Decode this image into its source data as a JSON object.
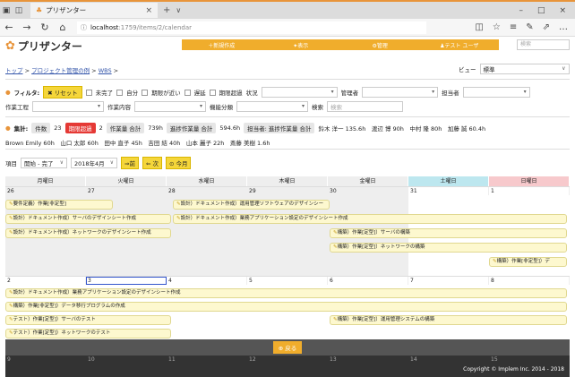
{
  "browser": {
    "tab_title": "プリザンター",
    "url_host": "localhost",
    "url_path": ":1759/items/2/calendar"
  },
  "app": {
    "logo_text": "プリザンター",
    "menu": [
      "＋新規作成",
      "✦表示",
      "⚙管理",
      "♟テスト ユーザ"
    ],
    "search_placeholder": "検索"
  },
  "breadcrumb": [
    "トップ",
    "プロジェクト管理の例",
    "WBS"
  ],
  "view": {
    "label": "ビュー",
    "value": "標準"
  },
  "filter": {
    "title": "フィルタ:",
    "reset": "✖ リセット",
    "checks": [
      "未完了",
      "自分",
      "期限が近い",
      "遅延",
      "期限超過"
    ],
    "status_label": "状況",
    "manager_label": "管理者",
    "owner_label": "担当者",
    "process_label": "作業工程",
    "content_label": "作業内容",
    "category_label": "機能分類",
    "search_label": "検索",
    "search_placeholder": "検索"
  },
  "aggregate": {
    "title": "集計:",
    "count_label": "件数",
    "count": "23",
    "overdue_label": "期限超過",
    "overdue": "2",
    "work_total_label": "作業量 合計",
    "work_total": "739h",
    "progress_total_label": "進捗作業量 合計",
    "progress_total": "594.6h",
    "owner_progress_label": "担当者: 進捗作業量 合計",
    "owner_line1": "鈴木 洋一 135.6h　渡辺 博 90h　中村 隆 80h　加藤 誠 60.4h",
    "owner_line2": "Brown Emily 60h　山口 太郎 60h　田中 直子 45h　吉田 結 40h　山本 麗子 22h　斎藤 美樹 1.6h"
  },
  "toolbar": {
    "item_label": "項目",
    "item_value": "開始 - 完了",
    "month_value": "2018年4月",
    "prev": "⇒前",
    "next": "⇐ 次",
    "today": "⊙ 今月"
  },
  "calendar": {
    "weekdays": [
      "月曜日",
      "火曜日",
      "水曜日",
      "木曜日",
      "金曜日",
      "土曜日",
      "日曜日"
    ],
    "week1_days": [
      "26",
      "27",
      "28",
      "29",
      "30",
      "31",
      "1"
    ],
    "week2_days": [
      "2",
      "3",
      "4",
      "5",
      "6",
      "7",
      "8"
    ],
    "week3_days": [
      "9",
      "10",
      "11",
      "12",
      "13",
      "14",
      "15"
    ],
    "week1_bars": [
      "要件定義）作業[非定型]",
      "設計）ドキュメント作成）サーバのデザインシート作成",
      "設計）ドキュメント作成）ネットワークのデザインシート作成",
      "設計）ドキュメント作成）運用管理ソフトウェアのデザインシー",
      "設計）ドキュメント作成）業務アプリケーション設定のデザインシート作成",
      "構築）作業[定型]）サーバの構築",
      "構築）作業[定型]）ネットワークの構築",
      "構築）作業[非定型]）デ"
    ],
    "week2_bars": [
      "設計）ドキュメント作成）業務アプリケーション設定のデザインシート作成",
      "構築）作業[非定型]）データ移行プログラムの作成",
      "テスト）作業[定型]）サーバのテスト",
      "構築）作業[定型]）運用管理システムの構築",
      "テスト）作業[定型]）ネットワークのテスト"
    ]
  },
  "back_button": "⊕ 戻る",
  "copyright": "Copyright © Implem Inc. 2014 - 2018"
}
